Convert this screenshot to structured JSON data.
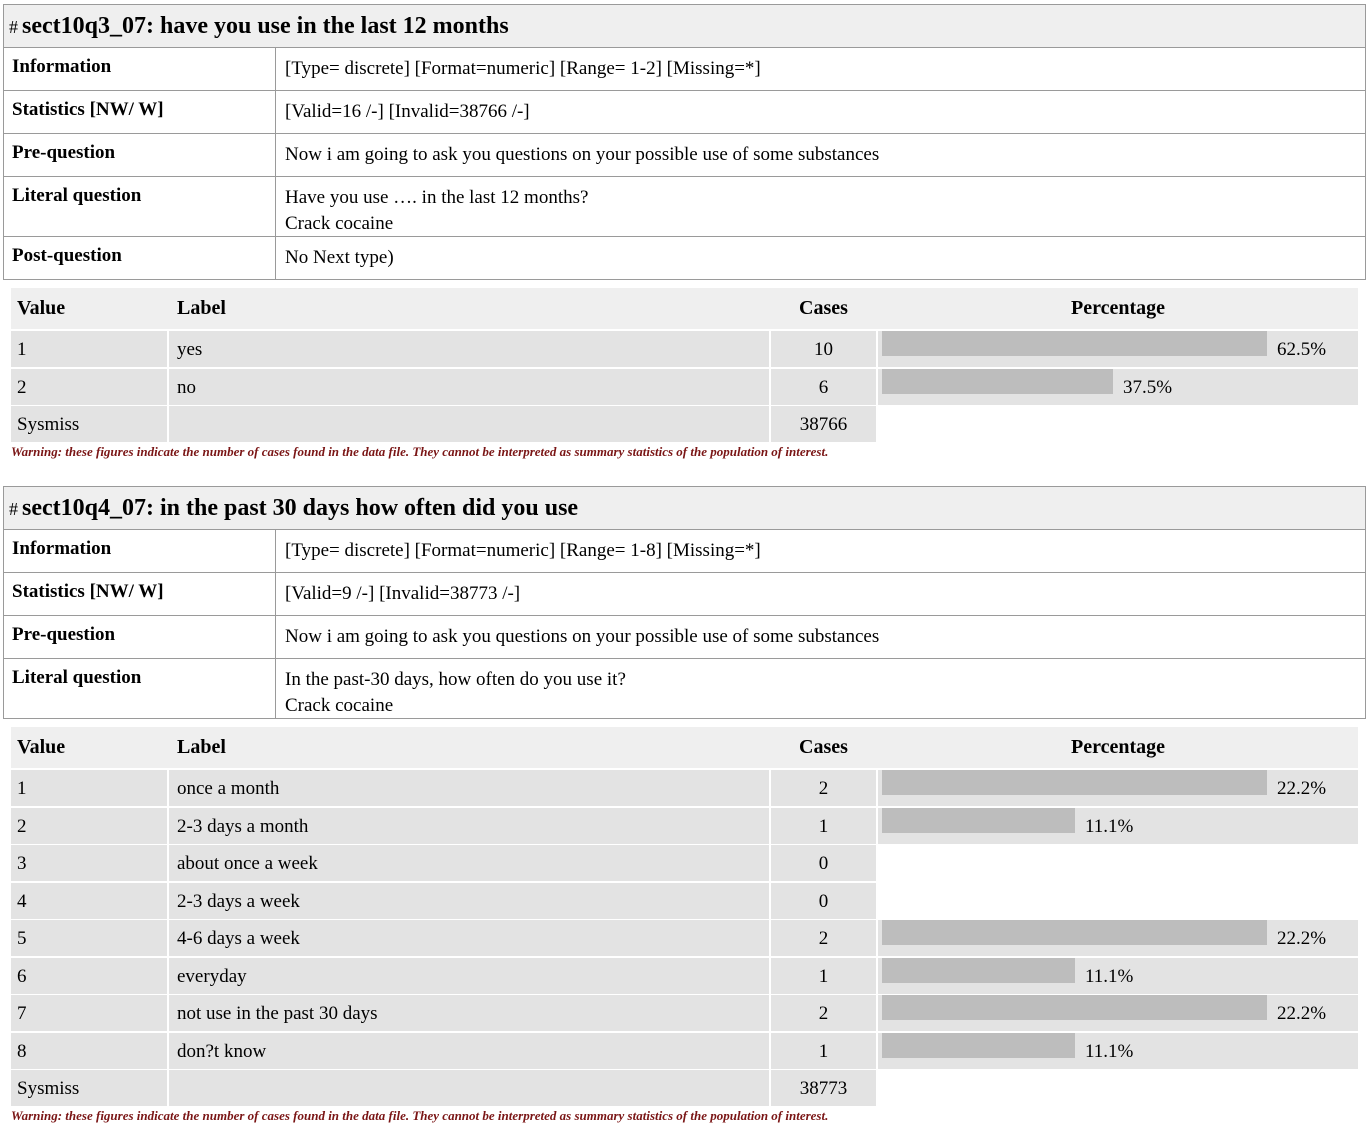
{
  "variables": [
    {
      "title": "sect10q3_07: have you use in the last 12 months",
      "hash": "#",
      "info": [
        {
          "key": "Information",
          "value": "[Type= discrete] [Format=numeric] [Range= 1-2] [Missing=*]"
        },
        {
          "key": "Statistics [NW/ W]",
          "value": "[Valid=16 /-] [Invalid=38766 /-]"
        },
        {
          "key": "Pre-question",
          "value": "Now i am going to ask you questions on your possible use of some substances"
        },
        {
          "key": "Literal question",
          "value": "Have you use …. in the last 12 months?",
          "value2": "Crack cocaine"
        },
        {
          "key": "Post-question",
          "value": "No Next type)"
        }
      ],
      "freq_headers": {
        "value": "Value",
        "label": "Label",
        "cases": "Cases",
        "percentage": "Percentage"
      },
      "rows": [
        {
          "value": "1",
          "label": "yes",
          "cases": "10",
          "pct": 62.5,
          "pct_label": "62.5%"
        },
        {
          "value": "2",
          "label": "no",
          "cases": "6",
          "pct": 37.5,
          "pct_label": "37.5%"
        }
      ],
      "sysmiss": {
        "label": "Sysmiss",
        "cases": "38766"
      },
      "warning": "Warning: these figures indicate the number of cases found in the data file. They cannot be interpreted as summary statistics of the population of interest."
    },
    {
      "title": "sect10q4_07: in the past 30 days how often did you use",
      "hash": "#",
      "info": [
        {
          "key": "Information",
          "value": "[Type= discrete] [Format=numeric] [Range= 1-8] [Missing=*]"
        },
        {
          "key": "Statistics [NW/ W]",
          "value": "[Valid=9 /-] [Invalid=38773 /-]"
        },
        {
          "key": "Pre-question",
          "value": "Now i am going to ask you questions on your possible use of some substances"
        },
        {
          "key": "Literal question",
          "value": "In the past-30 days, how often do you use it?",
          "value2": "Crack cocaine"
        }
      ],
      "freq_headers": {
        "value": "Value",
        "label": "Label",
        "cases": "Cases",
        "percentage": "Percentage"
      },
      "rows": [
        {
          "value": "1",
          "label": "once a month",
          "cases": "2",
          "pct": 22.2,
          "pct_label": "22.2%"
        },
        {
          "value": "2",
          "label": "2-3 days a month",
          "cases": "1",
          "pct": 11.1,
          "pct_label": "11.1%"
        },
        {
          "value": "3",
          "label": "about once a week",
          "cases": "0",
          "pct": 0,
          "pct_label": ""
        },
        {
          "value": "4",
          "label": "2-3 days a week",
          "cases": "0",
          "pct": 0,
          "pct_label": ""
        },
        {
          "value": "5",
          "label": "4-6 days a week",
          "cases": "2",
          "pct": 22.2,
          "pct_label": "22.2%"
        },
        {
          "value": "6",
          "label": "everyday",
          "cases": "1",
          "pct": 11.1,
          "pct_label": "11.1%"
        },
        {
          "value": "7",
          "label": "not use in the past 30 days",
          "cases": "2",
          "pct": 22.2,
          "pct_label": "22.2%"
        },
        {
          "value": "8",
          "label": "don?t know",
          "cases": "1",
          "pct": 11.1,
          "pct_label": "11.1%"
        }
      ],
      "sysmiss": {
        "label": "Sysmiss",
        "cases": "38773"
      },
      "warning": "Warning: these figures indicate the number of cases found in the data file. They cannot be interpreted as summary statistics of the population of interest."
    }
  ]
}
